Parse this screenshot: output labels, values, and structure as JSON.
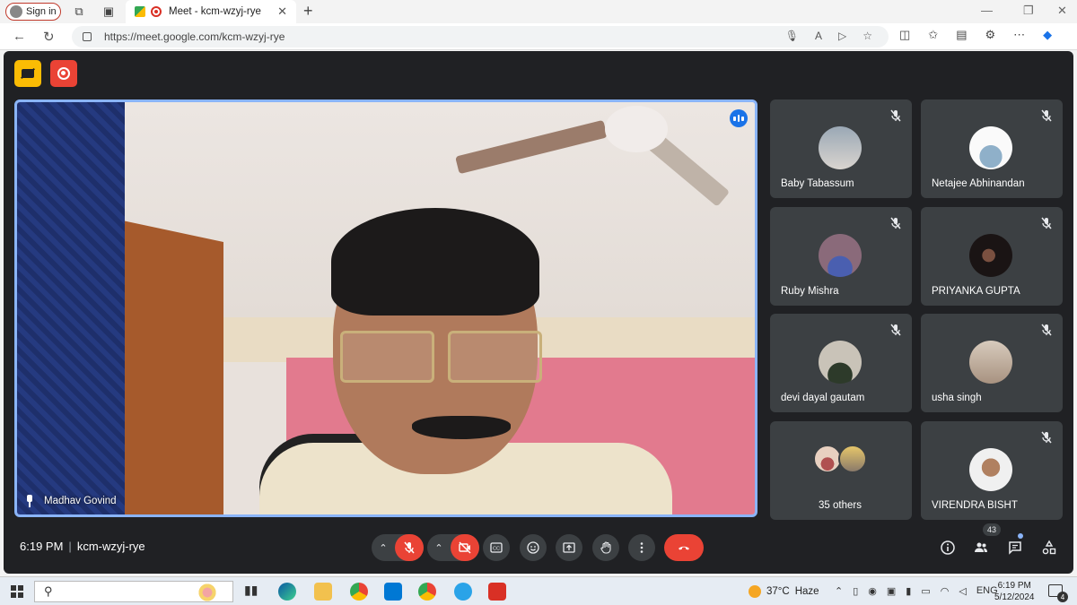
{
  "browser": {
    "signin_label": "Sign in",
    "tab_title": "Meet - kcm-wzyj-rye",
    "url": "https://meet.google.com/kcm-wzyj-rye"
  },
  "meet": {
    "main_speaker": "Madhav Govind",
    "participants": [
      {
        "name": "Baby Tabassum",
        "muted": true,
        "avatar_color": "#8a9aa8"
      },
      {
        "name": "Netajee Abhinandan",
        "muted": true,
        "avatar_color": "#f2f2f2"
      },
      {
        "name": "Ruby Mishra",
        "muted": true,
        "avatar_color": "#7a5a8a"
      },
      {
        "name": "PRIYANKA GUPTA",
        "muted": true,
        "avatar_color": "#2a2020"
      },
      {
        "name": "devi dayal gautam",
        "muted": true,
        "avatar_color": "#5a6a58"
      },
      {
        "name": "usha singh",
        "muted": true,
        "avatar_color": "#c9b8a8"
      },
      {
        "name": "35 others",
        "muted": false,
        "avatar_color": "#c06a6a"
      },
      {
        "name": "VIRENDRA BISHT",
        "muted": true,
        "avatar_color": "#eeeeee"
      }
    ],
    "time": "6:19 PM",
    "meeting_code": "kcm-wzyj-rye",
    "participant_count": "43"
  },
  "taskbar": {
    "weather_temp": "37°C",
    "weather_desc": "Haze",
    "language": "ENG",
    "clock_time": "6:19 PM",
    "clock_date": "5/12/2024",
    "notification_count": "4"
  },
  "colors": {
    "meet_bg": "#202124",
    "tile_bg": "#3c4043",
    "red_accent": "#ea4335",
    "active_border": "#8ab4f8"
  }
}
